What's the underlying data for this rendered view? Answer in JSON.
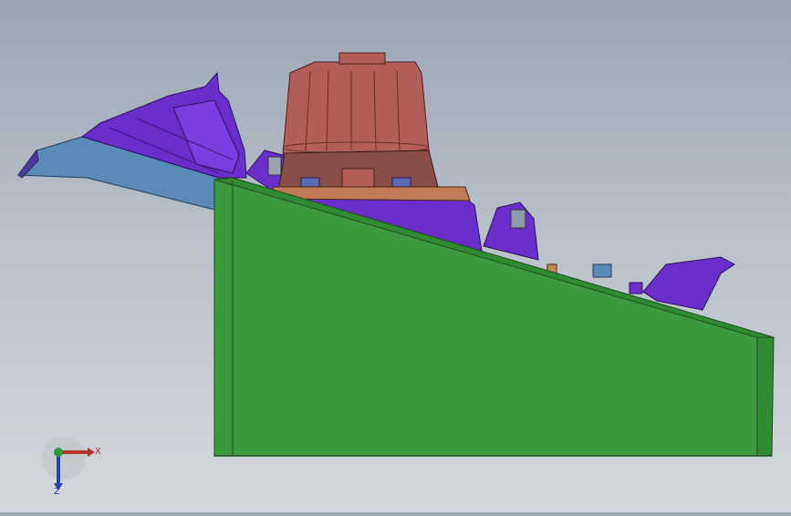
{
  "viewport": {
    "colors": {
      "background_top": "#9aa6b4",
      "background_bottom": "#d4d8dc",
      "base_body": "#3a9a3c",
      "base_edge": "#1f4f20",
      "purple_parts": "#6a2ecb",
      "motor_housing": "#b35e5a",
      "tray": "#5a8ab8"
    }
  },
  "triad": {
    "x_label": "X",
    "z_label": "Z",
    "x_color": "#b5302a",
    "z_color": "#2a3fb0",
    "y_color": "#2a9a3a"
  }
}
